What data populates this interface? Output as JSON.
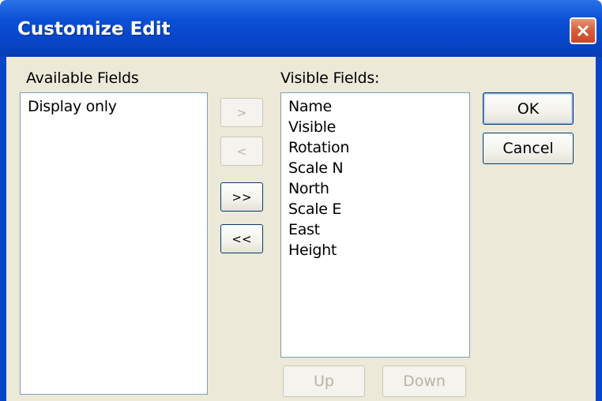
{
  "window": {
    "title": "Customize Edit"
  },
  "available": {
    "label": "Available Fields",
    "items": [
      "Display only"
    ]
  },
  "visible": {
    "label": "Visible Fields:",
    "items": [
      "Name",
      "Visible",
      "Rotation",
      "Scale N",
      "North",
      "Scale E",
      "East",
      "Height"
    ]
  },
  "move_buttons": {
    "add_one": ">",
    "remove_one": "<",
    "add_all": ">>",
    "remove_all": "<<"
  },
  "actions": {
    "ok": "OK",
    "cancel": "Cancel",
    "up": "Up",
    "down": "Down"
  },
  "colors": {
    "titlebar": "#0746c9",
    "close": "#d8603c",
    "dialog_bg": "#ece9d8"
  }
}
